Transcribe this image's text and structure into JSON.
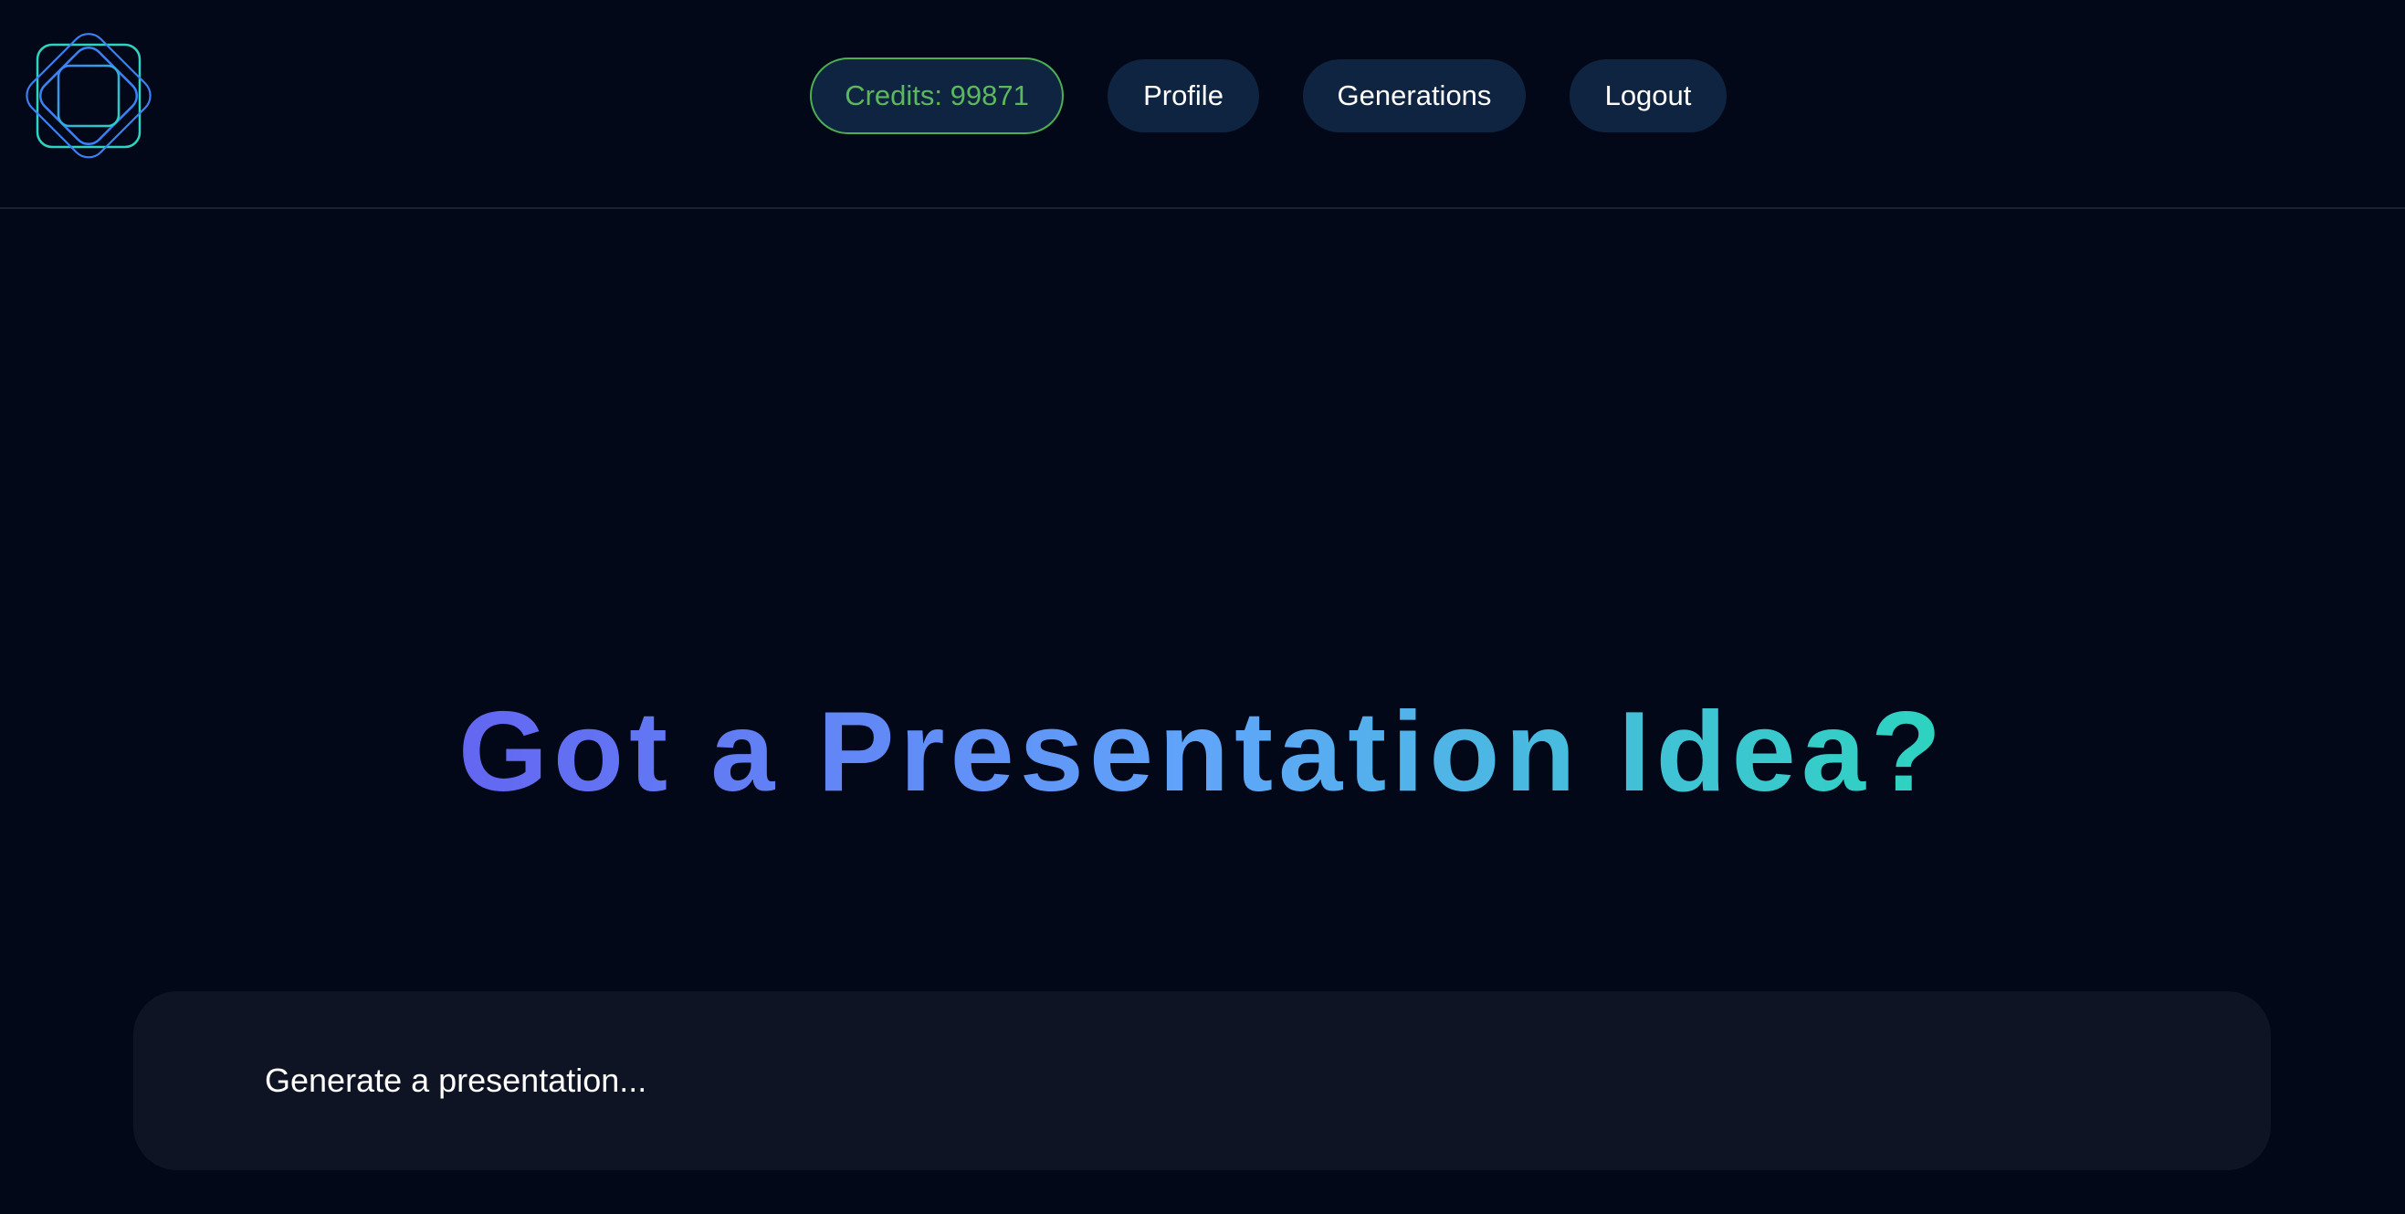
{
  "header": {
    "logo_icon": "diamond-squares-logo-icon",
    "credits_label": "Credits: 99871",
    "nav": {
      "profile": "Profile",
      "generations": "Generations",
      "logout": "Logout"
    }
  },
  "hero": {
    "title": "Got a Presentation Idea?",
    "gradient_start": "#6366f1",
    "gradient_mid": "#60a5fa",
    "gradient_end": "#2dd4bf"
  },
  "prompt": {
    "placeholder": "Generate a presentation..."
  },
  "colors": {
    "background": "#020817",
    "nav_button": "#0f2440",
    "credits_accent": "#5cb85c",
    "prompt_box": "#0f1424"
  }
}
